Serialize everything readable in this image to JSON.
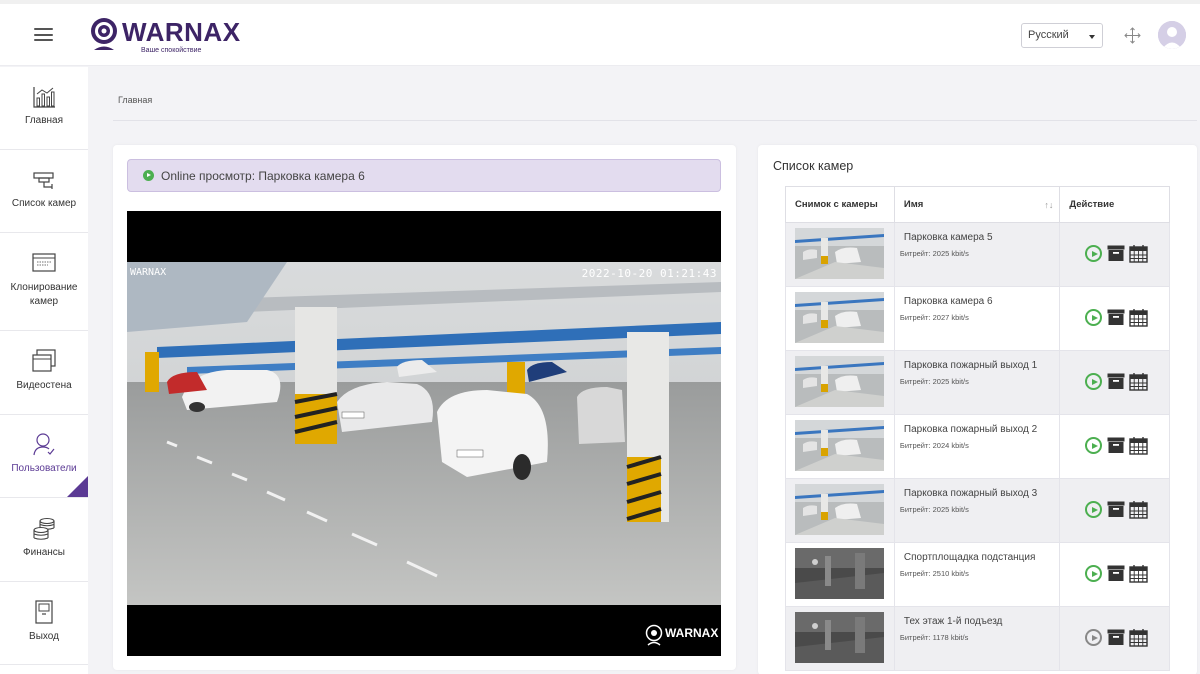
{
  "header": {
    "logo_text": "WARNAX",
    "logo_tagline": "Ваше спокойствие",
    "language": "Русский"
  },
  "sidebar": {
    "items": [
      {
        "label": "Главная",
        "icon": "chart-icon"
      },
      {
        "label": "Список камер",
        "icon": "camera-icon"
      },
      {
        "label": "Клонирование камер",
        "icon": "clone-icon"
      },
      {
        "label": "Видеостена",
        "icon": "videowall-icon"
      },
      {
        "label": "Пользователи",
        "icon": "user-icon"
      },
      {
        "label": "Финансы",
        "icon": "coins-icon"
      },
      {
        "label": "Выход",
        "icon": "exit-icon"
      }
    ],
    "active_index": 4
  },
  "breadcrumb": "Главная",
  "viewer": {
    "title": "Online просмотр: Парковка камера 6",
    "overlay_brand": "WARNAX",
    "overlay_timestamp": "2022-10-20 01:21:43",
    "watermark": "WARNAX"
  },
  "camera_list": {
    "title": "Список камер",
    "columns": [
      "Снимок с камеры",
      "Имя",
      "Действие"
    ],
    "rows": [
      {
        "name": "Парковка камера 5",
        "bitrate": "Битрейт: 2025 kbit/s",
        "thumb": "parking",
        "online": true
      },
      {
        "name": "Парковка камера 6",
        "bitrate": "Битрейт: 2027 kbit/s",
        "thumb": "parking",
        "online": true
      },
      {
        "name": "Парковка пожарный выход 1",
        "bitrate": "Битрейт: 2025 kbit/s",
        "thumb": "parking",
        "online": true
      },
      {
        "name": "Парковка пожарный выход 2",
        "bitrate": "Битрейт: 2024 kbit/s",
        "thumb": "parking",
        "online": true
      },
      {
        "name": "Парковка пожарный выход 3",
        "bitrate": "Битрейт: 2025 kbit/s",
        "thumb": "parking",
        "online": true
      },
      {
        "name": "Спортплощадка подстанция",
        "bitrate": "Битрейт: 2510 kbit/s",
        "thumb": "night",
        "online": true
      },
      {
        "name": "Тех этаж 1-й подъезд",
        "bitrate": "Битрейт: 1178 kbit/s",
        "thumb": "night",
        "online": false
      }
    ]
  },
  "colors": {
    "brand": "#3d2466",
    "accent": "#5b3a94",
    "alert_bg": "#e3dcef",
    "online": "#4caf50"
  }
}
